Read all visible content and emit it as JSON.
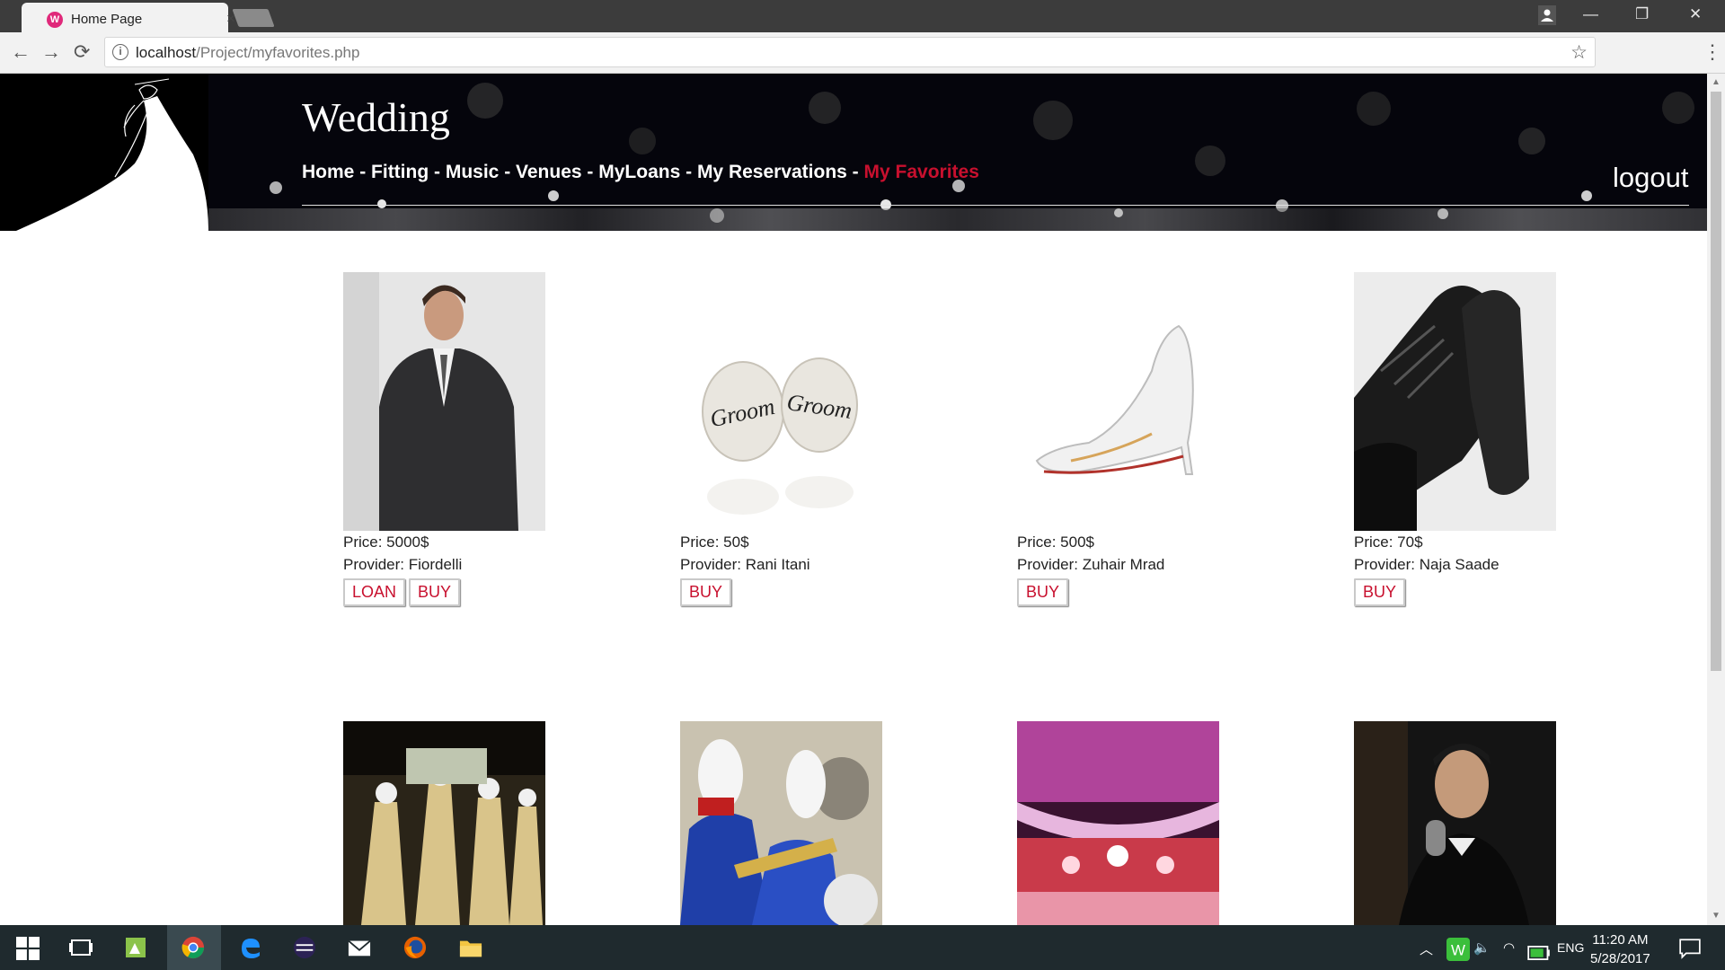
{
  "browser": {
    "tab_title": "Home Page",
    "tab_close": "×",
    "url_host": "localhost",
    "url_path": "/Project/myfavorites.php",
    "info_icon": "i",
    "star_icon": "☆",
    "back_icon": "←",
    "forward_icon": "→",
    "reload_icon": "⟳",
    "menu_icon": "⋮",
    "minimize": "—",
    "restore": "❐",
    "close": "✕"
  },
  "site": {
    "title": "Wedding",
    "nav": [
      {
        "label": "Home"
      },
      {
        "label": "Fitting"
      },
      {
        "label": "Music"
      },
      {
        "label": "Venues"
      },
      {
        "label": "MyLoans"
      },
      {
        "label": "My Reservations"
      },
      {
        "label": "My Favorites",
        "active": true
      }
    ],
    "nav_separator": " - ",
    "logout": "logout",
    "active_color": "#c8102e"
  },
  "products": [
    {
      "price": "Price: 5000$",
      "provider": "Provider: Fiordelli",
      "loan": "LOAN",
      "buy": "BUY",
      "image": "groom-suit"
    },
    {
      "price": "Price: 50$",
      "provider": "Provider: Rani Itani",
      "buy": "BUY",
      "image": "groom-cufflinks",
      "cufflink_text": "Groom"
    },
    {
      "price": "Price: 500$",
      "provider": "Provider: Zuhair Mrad",
      "buy": "BUY",
      "image": "white-heel"
    },
    {
      "price": "Price: 70$",
      "provider": "Provider: Naja Saade",
      "buy": "BUY",
      "image": "black-shoes"
    }
  ],
  "products_row2": [
    {
      "image": "zaffe-troupe"
    },
    {
      "image": "marching-band"
    },
    {
      "image": "venue-hall"
    },
    {
      "image": "singer"
    }
  ],
  "taskbar": {
    "lang": "ENG",
    "time": "11:20 AM",
    "date": "5/28/2017"
  }
}
